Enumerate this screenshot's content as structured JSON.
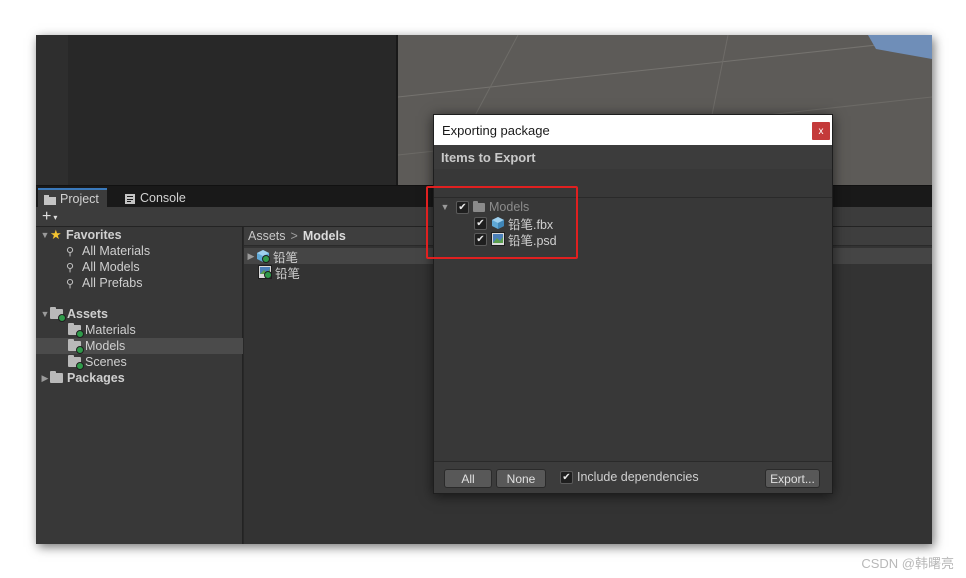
{
  "tabs": [
    {
      "label": "Project",
      "active": true,
      "icon": "folder-icon"
    },
    {
      "label": "Console",
      "active": false,
      "icon": "console-icon"
    }
  ],
  "toolbar": {
    "create_label": "+",
    "create_caret": "▾"
  },
  "tree": {
    "favorites": {
      "label": "Favorites",
      "items": [
        "All Materials",
        "All Models",
        "All Prefabs"
      ]
    },
    "assets": {
      "label": "Assets",
      "items": [
        "Materials",
        "Models",
        "Scenes"
      ],
      "selected": "Models"
    },
    "packages": {
      "label": "Packages"
    }
  },
  "breadcrumb": {
    "root": "Assets",
    "separator": ">",
    "current": "Models"
  },
  "assets_list": [
    {
      "name": "铅笔",
      "icon": "model-icon",
      "expandable": true,
      "selected": true
    },
    {
      "name": "铅笔",
      "icon": "texture-icon",
      "expandable": false,
      "selected": false
    }
  ],
  "dialog": {
    "title": "Exporting package",
    "close_label": "x",
    "header": "Items to Export",
    "items": [
      {
        "name": "Models",
        "type": "folder",
        "checked": true
      },
      {
        "name": "铅笔.fbx",
        "type": "model",
        "checked": true
      },
      {
        "name": "铅笔.psd",
        "type": "texture",
        "checked": true
      }
    ],
    "buttons": {
      "all": "All",
      "none": "None",
      "export": "Export..."
    },
    "include_dependencies": {
      "label": "Include dependencies",
      "checked": true
    }
  },
  "watermark": "CSDN @韩曙亮",
  "colors": {
    "highlight": "#e02020",
    "close": "#c43a3a",
    "accent": "#3a79bb"
  }
}
